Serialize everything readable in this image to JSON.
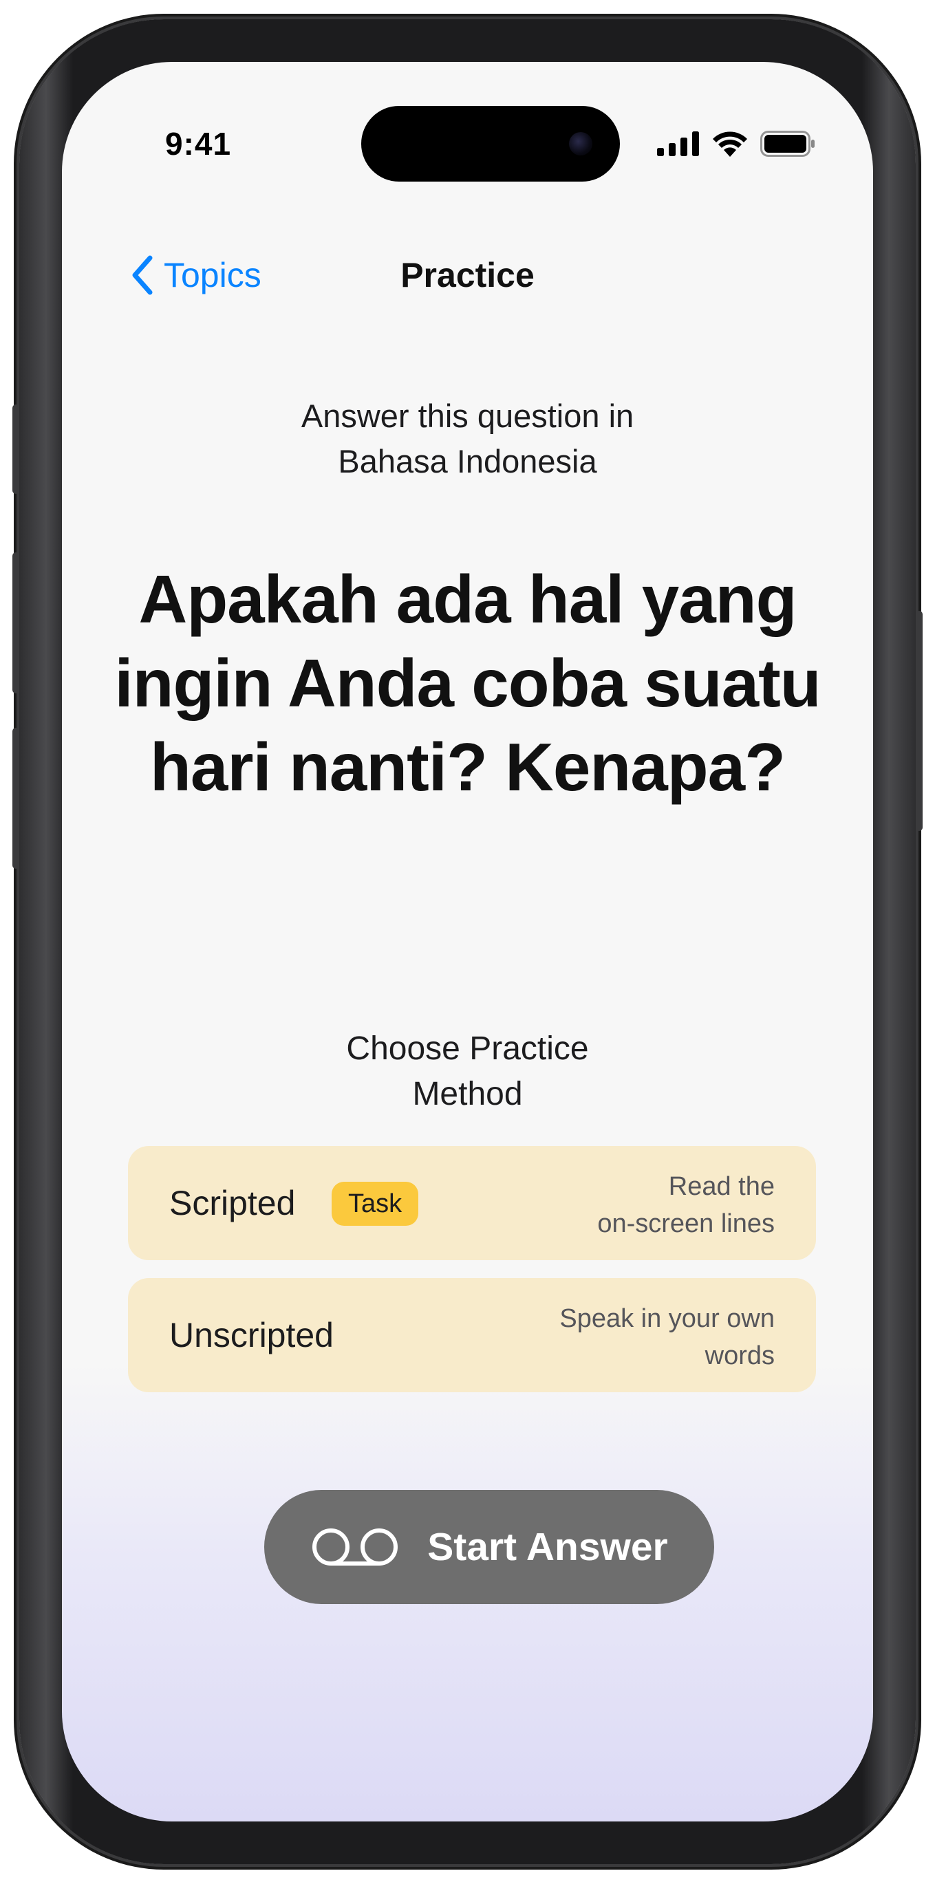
{
  "status_bar": {
    "time": "9:41",
    "icons": [
      "cellular-signal-icon",
      "wifi-icon",
      "battery-icon"
    ]
  },
  "nav": {
    "back_label": "Topics",
    "title": "Practice"
  },
  "instruction": {
    "line1": "Answer this question in",
    "line2": "Bahasa Indonesia"
  },
  "question": {
    "line1": "Apakah ada hal yang",
    "line2": "ingin Anda coba suatu",
    "line3": "hari nanti? Kenapa?"
  },
  "method": {
    "title_line1": "Choose Practice",
    "title_line2": "Method",
    "options": [
      {
        "label": "Scripted",
        "badge": "Task",
        "desc_line1": "Read the",
        "desc_line2": "on-screen lines"
      },
      {
        "label": "Unscripted",
        "desc_line1": "Speak in your own",
        "desc_line2": "words"
      }
    ]
  },
  "start_button": {
    "label": "Start Answer",
    "icon": "voicemail-icon"
  },
  "colors": {
    "accent": "#0a84ff",
    "option_bg": "#f8ebcb",
    "badge_bg": "#fbc93d",
    "button_bg": "#6e6e6e",
    "gradient_bottom": "#dcdaf5"
  }
}
